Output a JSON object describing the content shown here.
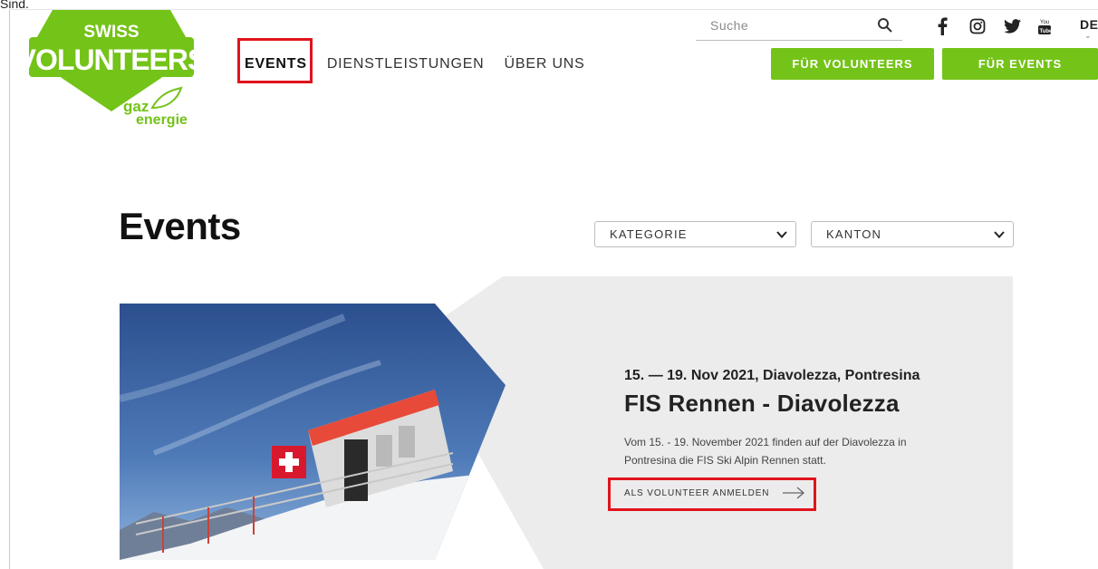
{
  "top_cut_text": "Sind.",
  "logo": {
    "line1": "SWISS",
    "line2": "VOLUNTEERS",
    "sponsor1": "gaz",
    "sponsor2": "energie"
  },
  "nav": {
    "items": [
      {
        "label": "EVENTS"
      },
      {
        "label": "DIENSTLEISTUNGEN"
      },
      {
        "label": "ÜBER UNS"
      }
    ]
  },
  "search": {
    "placeholder": "Suche"
  },
  "social": [
    "facebook-icon",
    "instagram-icon",
    "twitter-icon",
    "youtube-icon"
  ],
  "lang": {
    "current": "DE"
  },
  "buttons": {
    "volunteers": "FÜR VOLUNTEERS",
    "events": "FÜR EVENTS"
  },
  "page": {
    "title": "Events"
  },
  "filters": {
    "category": "KATEGORIE",
    "canton": "KANTON"
  },
  "event": {
    "date_location": "15. — 19. Nov 2021, Diavolezza, Pontresina",
    "title": "FIS Rennen - Diavolezza",
    "description": "Vom 15. - 19. November 2021 finden auf der Diavolezza in Pontresina die FIS Ski Alpin Rennen statt.",
    "cta": "ALS VOLUNTEER ANMELDEN"
  },
  "colors": {
    "brand_green": "#74c318",
    "highlight_red": "#e0141c",
    "card_grey": "#ececec"
  }
}
